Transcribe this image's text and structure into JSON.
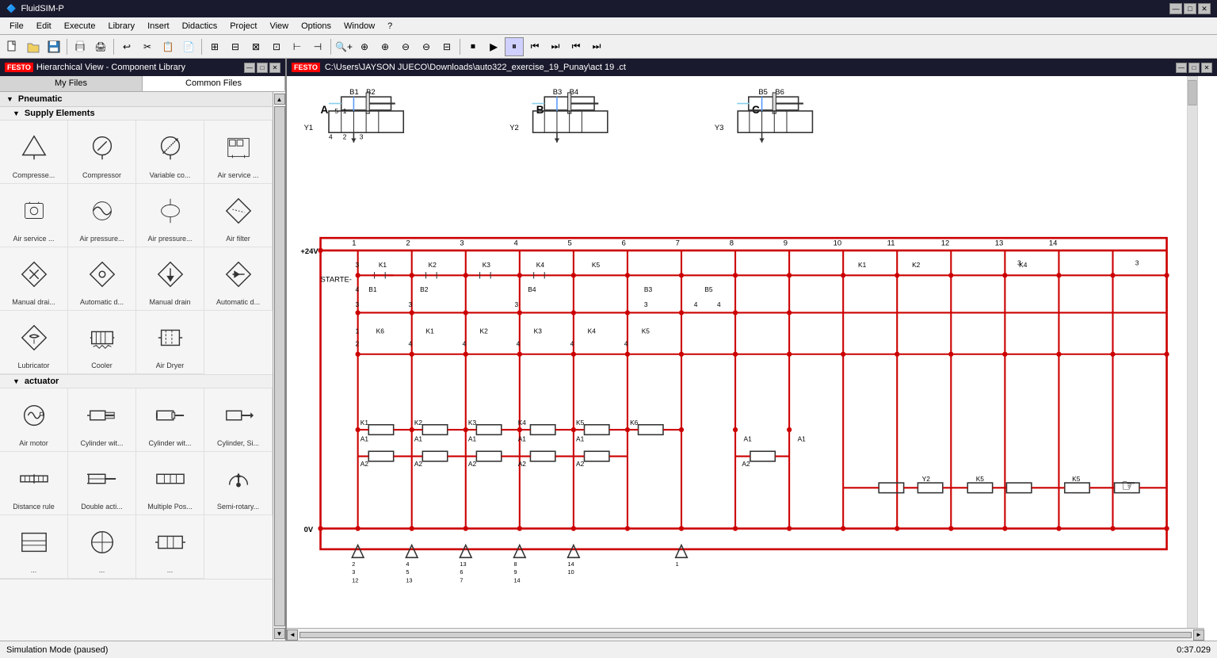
{
  "app": {
    "title": "FluidSIM-P",
    "logo": "festo"
  },
  "titlebar": {
    "title": "FluidSIM-P",
    "min": "—",
    "max": "□",
    "close": "✕"
  },
  "menubar": {
    "items": [
      "File",
      "Edit",
      "Execute",
      "Library",
      "Insert",
      "Didactics",
      "Project",
      "View",
      "Options",
      "Window",
      "?"
    ]
  },
  "toolbar": {
    "buttons": [
      "📄",
      "📂",
      "💾",
      "🖨",
      "✂",
      "📋",
      "🔄",
      "📐",
      "📏",
      "▶",
      "⏹",
      "⏸",
      "⏭",
      "⏮",
      "🔍+",
      "🔍-",
      "🔲"
    ]
  },
  "left_panel": {
    "title": "Hierarchical View - Component Library",
    "tab_my_files": "My Files",
    "tab_common_files": "Common Files",
    "sections": [
      {
        "name": "Pneumatic",
        "expanded": true,
        "subsections": [
          {
            "name": "Supply Elements",
            "items": [
              {
                "label": "Compresse...",
                "icon": "compressor-tri"
              },
              {
                "label": "Compressor",
                "icon": "compressor-circle"
              },
              {
                "label": "Variable co...",
                "icon": "variable-comp"
              },
              {
                "label": "Air service ...",
                "icon": "air-service-unit"
              },
              {
                "label": "Air service ...",
                "icon": "air-service2"
              },
              {
                "label": "Air pressure...",
                "icon": "air-pressure"
              },
              {
                "label": "Air pressure...",
                "icon": "air-pressure2"
              },
              {
                "label": "Air filter",
                "icon": "air-filter"
              },
              {
                "label": "Manual drai...",
                "icon": "manual-drain"
              },
              {
                "label": "Automatic d...",
                "icon": "automatic-drain"
              },
              {
                "label": "Manual drain",
                "icon": "manual-drain2"
              },
              {
                "label": "Automatic d...",
                "icon": "automatic-drain2"
              },
              {
                "label": "Lubricator",
                "icon": "lubricator"
              },
              {
                "label": "Cooler",
                "icon": "cooler"
              },
              {
                "label": "Air Dryer",
                "icon": "air-dryer"
              }
            ]
          },
          {
            "name": "actuator",
            "items": [
              {
                "label": "Air motor",
                "icon": "air-motor"
              },
              {
                "label": "Cylinder wit...",
                "icon": "cylinder1"
              },
              {
                "label": "Cylinder wit...",
                "icon": "cylinder2"
              },
              {
                "label": "Cylinder, Si...",
                "icon": "cylinder3"
              },
              {
                "label": "Distance rule",
                "icon": "distance-rule"
              },
              {
                "label": "Double acti...",
                "icon": "double-actuator"
              },
              {
                "label": "Multiple Pos...",
                "icon": "multiple-pos"
              },
              {
                "label": "Semi-rotary...",
                "icon": "semi-rotary"
              },
              {
                "label": "...",
                "icon": "actuator-misc1"
              },
              {
                "label": "...",
                "icon": "actuator-misc2"
              },
              {
                "label": "...",
                "icon": "actuator-misc3"
              }
            ]
          }
        ]
      }
    ]
  },
  "right_panel": {
    "title": "C:\\Users\\JAYSON JUECO\\Downloads\\auto322_exercise_19_Punay\\act 19 .ct",
    "file_path": "C:\\Users\\JAYSON JUECO\\Downloads\\auto322_exercise_19_Punay\\act 19 .ct"
  },
  "status_bar": {
    "mode": "Simulation Mode (paused)",
    "time": "0:37.029"
  }
}
